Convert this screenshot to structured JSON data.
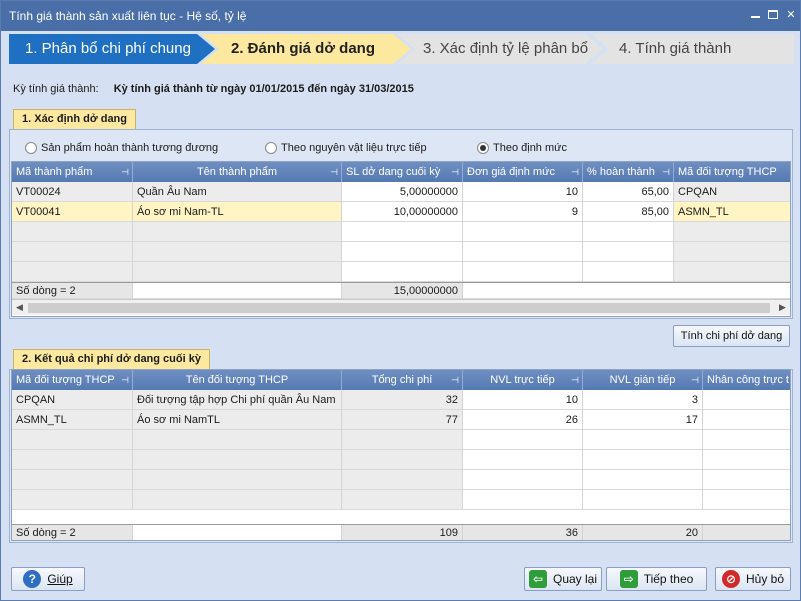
{
  "window": {
    "title": "Tính giá thành sản xuất liên tục - Hệ số, tỷ lệ"
  },
  "steps": [
    "1. Phân bổ chi phí chung",
    "2. Đánh giá dở dang",
    "3. Xác định tỷ lệ phân bổ",
    "4. Tính giá thành"
  ],
  "period": {
    "label": "Kỳ tính giá thành:",
    "value": "Kỳ tính giá thành từ ngày 01/01/2015 đến ngày 31/03/2015"
  },
  "section1": {
    "tab": "1. Xác định dở dang",
    "radios": [
      {
        "label": "Sản phẩm hoàn thành tương đương",
        "checked": false
      },
      {
        "label": "Theo nguyên vật liệu trực tiếp",
        "checked": false
      },
      {
        "label": "Theo định mức",
        "checked": true
      }
    ],
    "columns": [
      "Mã thành phẩm",
      "Tên thành phẩm",
      "SL dở dang cuối kỳ",
      "Đơn giá định mức",
      "% hoàn thành",
      "Mã đối tượng THCP"
    ],
    "rows": [
      [
        "VT00024",
        "Quần Âu Nam",
        "5,00000000",
        "10",
        "65,00",
        "CPQAN"
      ],
      [
        "VT00041",
        "Áo sơ mi Nam-TL",
        "10,00000000",
        "9",
        "85,00",
        "ASMN_TL"
      ]
    ],
    "footer": {
      "count": "Số dòng = 2",
      "sl_total": "15,00000000"
    },
    "calc_button": "Tính chi phí dở dang"
  },
  "section2": {
    "tab": "2. Kết quả chi phí dở dang cuối kỳ",
    "columns": [
      "Mã đối tượng THCP",
      "Tên đối tượng THCP",
      "Tổng chi phí",
      "NVL trực tiếp",
      "NVL gián tiếp",
      "Nhân công trực t"
    ],
    "rows": [
      [
        "CPQAN",
        "Đối tượng tập hợp Chi phí quần Âu Nam",
        "32",
        "10",
        "3",
        ""
      ],
      [
        "ASMN_TL",
        "Áo sơ mi NamTL",
        "77",
        "26",
        "17",
        ""
      ]
    ],
    "footer": {
      "count": "Số dòng = 2",
      "total": "109",
      "nvl_tt": "36",
      "nvl_gt": "20"
    }
  },
  "buttons": {
    "help": "Giúp",
    "back": "Quay lại",
    "next": "Tiếp theo",
    "cancel": "Hủy bỏ"
  }
}
